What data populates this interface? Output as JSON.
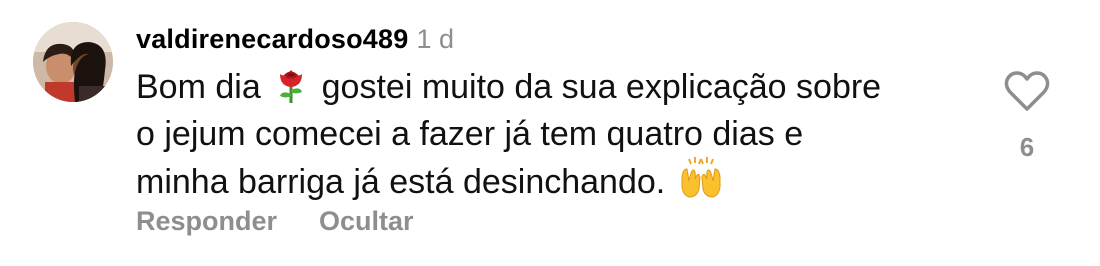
{
  "comment": {
    "username": "valdirenecardoso489",
    "time": "1 d",
    "text_line1_part1": "Bom dia",
    "text_line1_part2": "gostei muito da sua explicação sobre",
    "text_line2": "o jejum comecei a fazer já tem quatro dias e",
    "text_line3": "minha barriga já está desinchando.",
    "emoji_rose": "rose-emoji",
    "emoji_hands": "raising-hands-emoji",
    "like_count": "6",
    "like_icon": "heart-outline-icon"
  },
  "actions": {
    "reply_label": "Responder",
    "hide_label": "Ocultar"
  },
  "colors": {
    "secondary_text": "#8e8e8e",
    "primary_text": "#000000"
  }
}
